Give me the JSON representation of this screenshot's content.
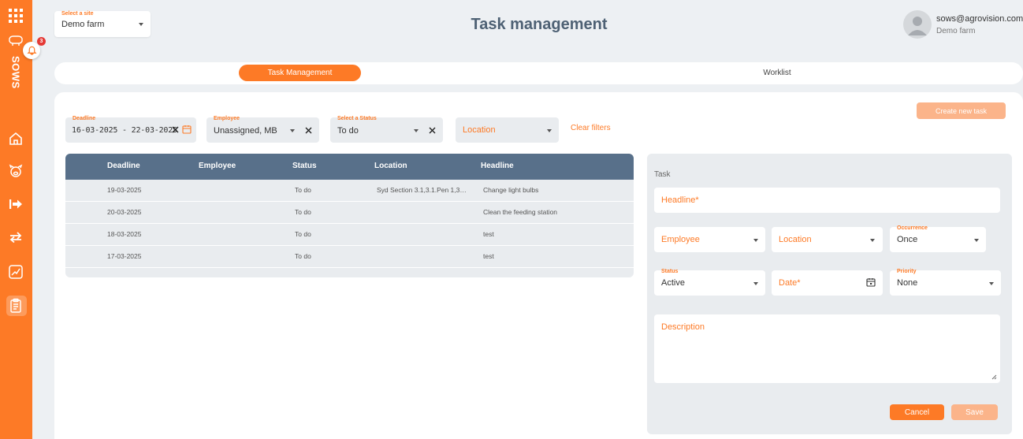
{
  "sidebar": {
    "brand": "SOWS",
    "notification_count": "3",
    "items": [
      {
        "icon": "grid-icon"
      },
      {
        "icon": "pig-icon"
      },
      {
        "icon": "home-icon"
      },
      {
        "icon": "sow-icon"
      },
      {
        "icon": "exit-arrow-icon"
      },
      {
        "icon": "transfer-icon"
      },
      {
        "icon": "chart-icon"
      },
      {
        "icon": "clipboard-icon"
      }
    ],
    "accent": "#fd7a26"
  },
  "header": {
    "site_label": "Select a site",
    "site_value": "Demo farm",
    "title": "Task management",
    "user_email": "sows@agrovision.com",
    "user_site": "Demo farm"
  },
  "tabs": [
    {
      "label": "Task Management",
      "active": true
    },
    {
      "label": "Worklist",
      "active": false
    }
  ],
  "filters": {
    "deadline_label": "Deadline",
    "deadline_value": "16-03-2025 - 22-03-2025",
    "employee_label": "Employee",
    "employee_value": "Unassigned, MB",
    "status_label": "Select a Status",
    "status_value": "To do",
    "location_placeholder": "Location",
    "clear_label": "Clear filters"
  },
  "create_button": "Create new task",
  "table": {
    "columns": [
      "Deadline",
      "Employee",
      "Status",
      "Location",
      "Headline"
    ],
    "rows": [
      {
        "deadline": "19-03-2025",
        "employee": "",
        "status": "To do",
        "location": "Syd Section 3.1,3.1.Pen 1,3.1...",
        "headline": "Change light bulbs"
      },
      {
        "deadline": "20-03-2025",
        "employee": "",
        "status": "To do",
        "location": "",
        "headline": "Clean the feeding station"
      },
      {
        "deadline": "18-03-2025",
        "employee": "",
        "status": "To do",
        "location": "",
        "headline": "test"
      },
      {
        "deadline": "17-03-2025",
        "employee": "",
        "status": "To do",
        "location": "",
        "headline": "test"
      }
    ]
  },
  "task_form": {
    "title": "Task",
    "headline_placeholder": "Headline*",
    "employee_placeholder": "Employee",
    "location_placeholder": "Location",
    "occurrence_label": "Occurrence",
    "occurrence_value": "Once",
    "status_label": "Status",
    "status_value": "Active",
    "date_placeholder": "Date*",
    "priority_label": "Priority",
    "priority_value": "None",
    "description_placeholder": "Description",
    "cancel_label": "Cancel",
    "save_label": "Save"
  }
}
